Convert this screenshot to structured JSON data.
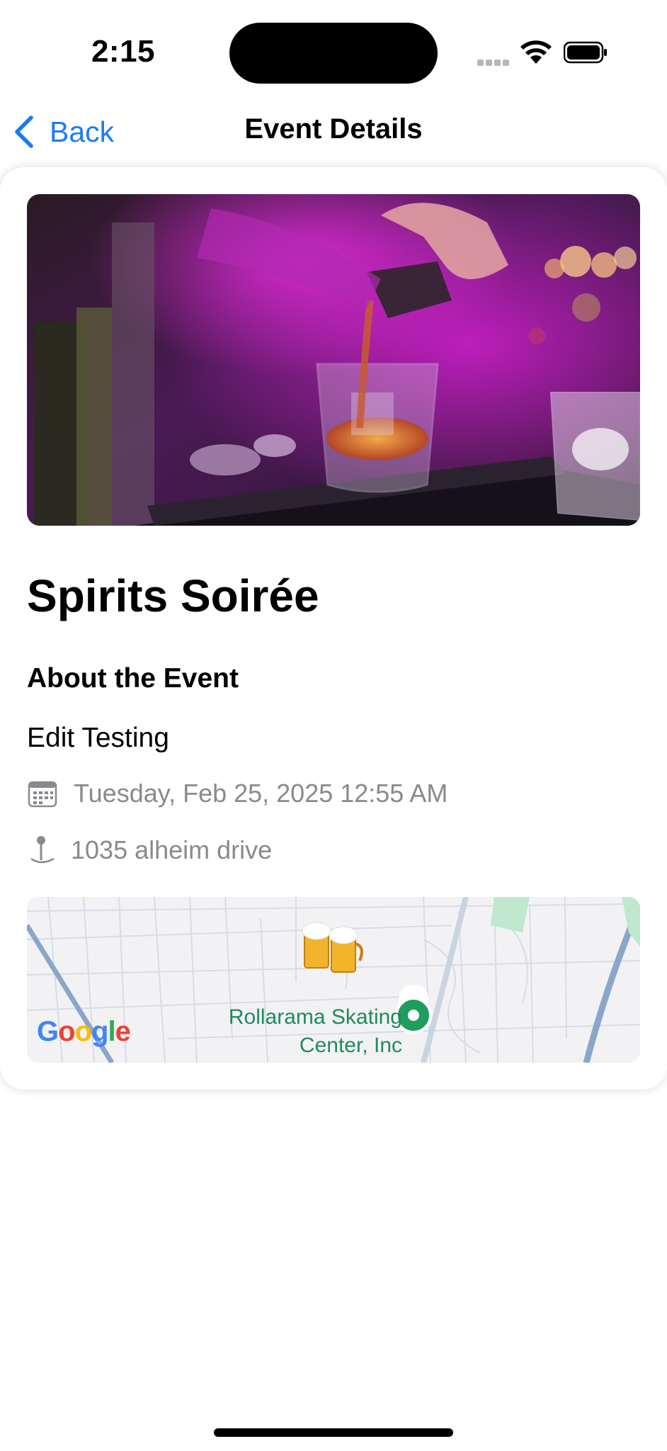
{
  "status_bar": {
    "time": "2:15"
  },
  "nav": {
    "back_label": "Back",
    "title": "Event Details"
  },
  "event": {
    "name": "Spirits Soirée",
    "about_heading": "About the Event",
    "description": "Edit Testing",
    "datetime": "Tuesday, Feb 25, 2025 12:55 AM",
    "address": "1035 alheim drive"
  },
  "map": {
    "place_label_line1": "Rollarama Skating",
    "place_label_line2": "Center, Inc",
    "provider_logo": [
      "G",
      "o",
      "o",
      "g",
      "l",
      "e"
    ],
    "provider_logo_colors": [
      "#4285F4",
      "#EA4335",
      "#FBBC05",
      "#4285F4",
      "#34A853",
      "#EA4335"
    ],
    "marker_icon": "beer-mugs-icon",
    "pin_color": "#1f9d5f"
  },
  "colors": {
    "accent": "#1a7cf5",
    "secondary_text": "#8a8a8e"
  }
}
